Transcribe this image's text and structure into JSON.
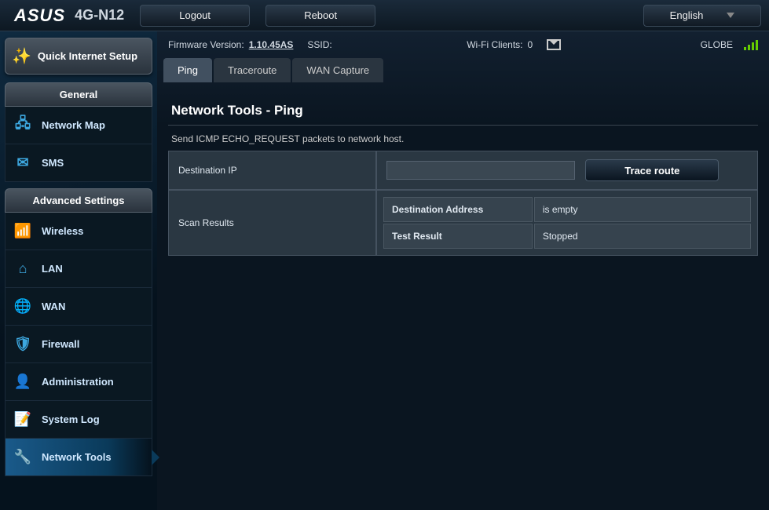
{
  "header": {
    "brand": "ASUS",
    "model": "4G-N12",
    "logout": "Logout",
    "reboot": "Reboot",
    "language": "English"
  },
  "info_bar": {
    "fw_label": "Firmware Version:",
    "fw_version": "1.10.45AS",
    "ssid_label": "SSID:",
    "ssid_value": "",
    "wifi_clients_label": "Wi-Fi Clients:",
    "wifi_clients_count": "0",
    "carrier": "GLOBE"
  },
  "sidebar": {
    "quick_setup": "Quick Internet Setup",
    "general_header": "General",
    "general_items": [
      {
        "label": "Network Map"
      },
      {
        "label": "SMS"
      }
    ],
    "advanced_header": "Advanced Settings",
    "advanced_items": [
      {
        "label": "Wireless"
      },
      {
        "label": "LAN"
      },
      {
        "label": "WAN"
      },
      {
        "label": "Firewall"
      },
      {
        "label": "Administration"
      },
      {
        "label": "System Log"
      },
      {
        "label": "Network Tools"
      }
    ]
  },
  "tabs": [
    {
      "label": "Ping",
      "active": true
    },
    {
      "label": "Traceroute",
      "active": false
    },
    {
      "label": "WAN Capture",
      "active": false
    }
  ],
  "page": {
    "title": "Network Tools - Ping",
    "description": "Send ICMP ECHO_REQUEST packets to network host.",
    "dest_ip_label": "Destination IP",
    "dest_ip_value": "",
    "trace_btn": "Trace route",
    "scan_results_label": "Scan Results",
    "results": [
      {
        "key": "Destination Address",
        "value": "is empty"
      },
      {
        "key": "Test Result",
        "value": "Stopped"
      }
    ]
  }
}
